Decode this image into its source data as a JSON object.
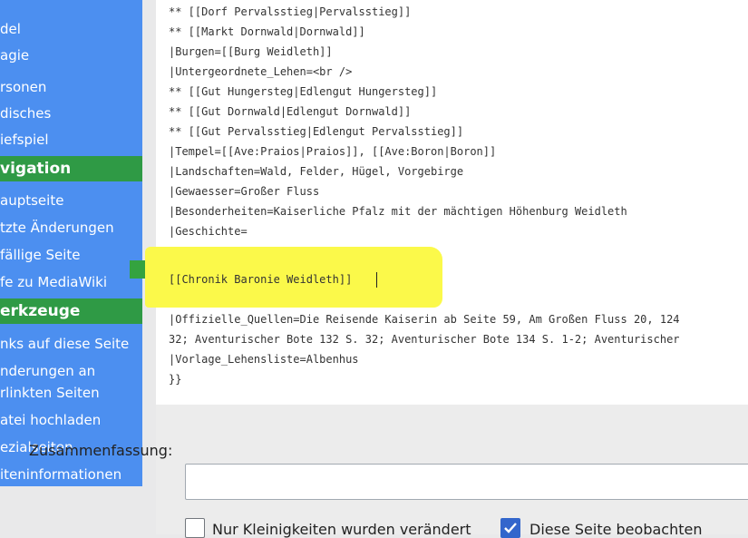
{
  "sidebar": {
    "top_links": [
      "del",
      "agie",
      "rsonen",
      "disches",
      "iefspiel"
    ],
    "navigation_heading": "vigation",
    "navigation_links": [
      "auptseite",
      "tzte Änderungen",
      "fällige Seite",
      "fe zu MediaWiki"
    ],
    "tools_heading": "erkzeuge",
    "tools_links": [
      "nks auf diese Seite",
      "nderungen an",
      "rlinkten Seiten",
      "atei hochladen",
      "ezialseiten",
      "iteninformationen"
    ]
  },
  "editor": {
    "lines": [
      "** [[Dorf Pervalsstieg|Pervalsstieg]]",
      "** [[Markt Dornwald|Dornwald]]",
      "|Burgen=[[Burg Weidleth]]",
      "|Untergeordnete_Lehen=<br />",
      "** [[Gut Hungersteg|Edlengut Hungersteg]]",
      "** [[Gut Dornwald|Edlengut Dornwald]]",
      "** [[Gut Pervalsstieg|Edlengut Pervalsstieg]]",
      "|Tempel=[[Ave:Praios|Praios]], [[Ave:Boron|Boron]]",
      "|Landschaften=Wald, Felder, Hügel, Vorgebirge",
      "|Gewaesser=Großer Fluss",
      "|Besonderheiten=Kaiserliche Pfalz mit der mächtigen Höhenburg Weidleth",
      "|Geschichte=",
      "",
      "[[Chronik Baronie Weidleth]]",
      "",
      "|Offizielle_Quellen=Die Reisende Kaiserin ab Seite 59, Am Großen Fluss 20, 124",
      "32; Aventurischer Bote 132 S. 32; Aventurischer Bote 134 S. 1-2; Aventurischer",
      "|Vorlage_Lehensliste=Albenhus",
      "}}"
    ]
  },
  "summary": {
    "label": "Zusammenfassung:",
    "value": "",
    "minor_edit_label": "Nur Kleinigkeiten wurden verändert",
    "minor_edit_checked": false,
    "watch_label": "Diese Seite beobachten",
    "watch_checked": true
  },
  "colors": {
    "sidebar_bg": "#4c8ff0",
    "section_heading_bg": "#2f9a45",
    "highlight": "#fbf94a",
    "checkbox_accent": "#3366cc"
  }
}
